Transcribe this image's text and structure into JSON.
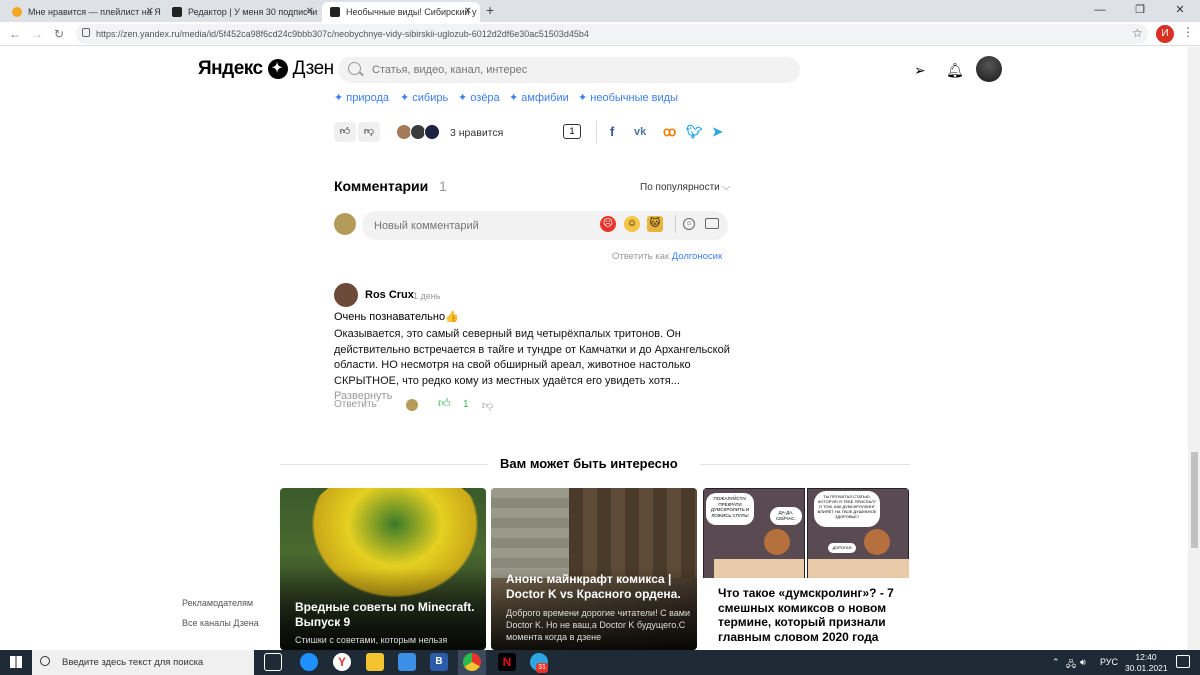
{
  "browser": {
    "tabs": [
      {
        "title": "Мне нравится — плейлист на Я",
        "active": false
      },
      {
        "title": "Редактор | У меня 30 подписчи",
        "active": false
      },
      {
        "title": "Необычные виды! Сибирский у",
        "active": true
      }
    ],
    "new_tab": "+",
    "url": "https://zen.yandex.ru/media/id/5f452ca98f6cd24c9bbb307c/neobychnye-vidy-sibirskii-uglozub-6012d2df6e30ac51503d45b4",
    "profile_letter": "И"
  },
  "header": {
    "logo_left": "Яндекс",
    "logo_right": "Дзен",
    "search_placeholder": "Статья, видео, канал, интерес"
  },
  "article": {
    "tags": [
      "природа",
      "сибирь",
      "озёра",
      "амфибии",
      "необычные виды"
    ],
    "likes_text": "3 нравится",
    "comments_badge": "1"
  },
  "comments": {
    "title": "Комментарии",
    "count": "1",
    "sort_label": "По популярности",
    "new_placeholder": "Новый комментарий",
    "reply_as_prefix": "Ответить как",
    "reply_as_name": "Долгоносик",
    "items": [
      {
        "author": "Ros Crux",
        "time": "1 день",
        "first_line": "Очень познавательно",
        "body": "Оказывается, это самый северный вид четырёхпалых тритонов. Он действительно встречается в тайге и тундре от Камчатки и до Архангельской области. НО несмотря на свой обширный ареал, животное настолько СКРЫТНОЕ, что редко кому из местных удаётся его увидеть хотя...",
        "expand": "Развернуть",
        "reply": "Ответить",
        "likes": "1"
      }
    ]
  },
  "recommendations": {
    "title": "Вам может быть интересно",
    "cards": [
      {
        "title": "Вредные советы по Minecraft. Выпуск 9",
        "subtitle": "Стишки с советами, которым нельзя"
      },
      {
        "title": "Анонс майнкрафт комикса | Doctor K vs Красного ордена.",
        "subtitle": "Доброго времени дорогие читатели! С вами Doctor K. Но не ваш,а Doctor K будущего.С момента когда в дзене"
      },
      {
        "title": "Что такое «думскролинг»? - 7 смешных комиксов о новом термине, который признали главным словом 2020 года",
        "subtitle": ""
      }
    ],
    "comic_bubbles": [
      "ПОЖАЛУЙСТА! ПРЕКРАТИ ДУМСКРОЛИТЬ И ЛОЖИСЬ СПАТЬ!",
      "ДА-ДА, СЕЙЧАС.",
      "ТЫ ПРОЧИТАЛ СТАТЬЮ, КОТОРУЮ Я ТЕБЕ ПРИСЛАЛ? О ТОМ, КАК ДУМСКРОЛЛИНГ ВЛИЯЕТ НА ТВОЕ ДУШЕВНОЕ ЗДОРОВЬЕ?",
      "ДОРОГАЯ"
    ]
  },
  "sidebar_links": [
    "Рекламодателям",
    "Все каналы Дзена"
  ],
  "taskbar": {
    "search_placeholder": "Введите здесь текст для поиска",
    "lang": "РУС",
    "time": "12:40",
    "date": "30.01.2021",
    "notification_badge": "31"
  },
  "colors": {
    "accent_blue": "#3d7ef2",
    "like_green": "#2db84d",
    "taskbar": "#1f2a37"
  }
}
